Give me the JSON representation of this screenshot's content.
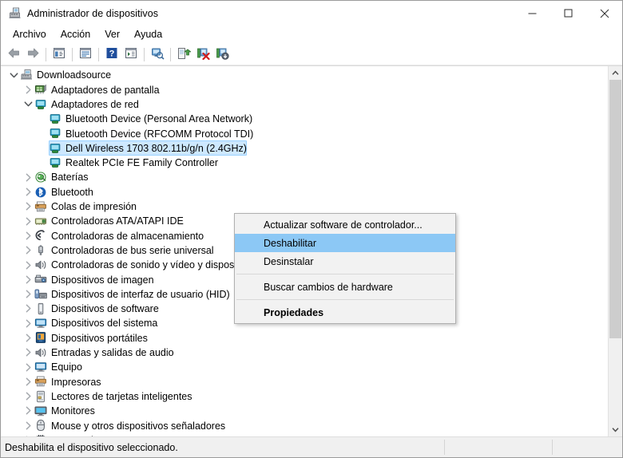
{
  "window": {
    "title": "Administrador de dispositivos",
    "title_icon": "device-manager-icon",
    "minimize_label": "—",
    "maximize_label": "□",
    "close_label": "✕"
  },
  "menubar": {
    "items": [
      {
        "label": "Archivo",
        "name": "menu-archivo"
      },
      {
        "label": "Acción",
        "name": "menu-accion"
      },
      {
        "label": "Ver",
        "name": "menu-ver"
      },
      {
        "label": "Ayuda",
        "name": "menu-ayuda"
      }
    ]
  },
  "toolbar": {
    "buttons": [
      {
        "name": "back-button",
        "icon": "back-arrow-icon"
      },
      {
        "name": "forward-button",
        "icon": "forward-arrow-icon"
      },
      {
        "name": "separator-1",
        "icon": "separator"
      },
      {
        "name": "show-hide-console-tree-button",
        "icon": "console-tree-icon"
      },
      {
        "name": "separator-2",
        "icon": "separator"
      },
      {
        "name": "properties-button",
        "icon": "properties-window-icon"
      },
      {
        "name": "separator-3",
        "icon": "separator"
      },
      {
        "name": "help-button",
        "icon": "help-question-icon"
      },
      {
        "name": "view-button",
        "icon": "view-list-icon"
      },
      {
        "name": "separator-4",
        "icon": "separator"
      },
      {
        "name": "scan-hardware-changes-button",
        "icon": "scan-hardware-icon"
      },
      {
        "name": "separator-5",
        "icon": "separator"
      },
      {
        "name": "update-driver-button",
        "icon": "update-driver-icon"
      },
      {
        "name": "uninstall-device-button",
        "icon": "uninstall-device-icon"
      },
      {
        "name": "disable-device-button",
        "icon": "disable-device-icon"
      }
    ]
  },
  "tree": {
    "nodes": [
      {
        "label": "Downloadsource",
        "indent": 0,
        "chevron": "expanded",
        "icon": "computer-icon",
        "selected": false
      },
      {
        "label": "Adaptadores de pantalla",
        "indent": 1,
        "chevron": "collapsed",
        "icon": "display-adapter-icon",
        "selected": false
      },
      {
        "label": "Adaptadores de red",
        "indent": 1,
        "chevron": "expanded",
        "icon": "network-adapter-icon",
        "selected": false
      },
      {
        "label": "Bluetooth Device (Personal Area Network)",
        "indent": 2,
        "chevron": "none",
        "icon": "network-adapter-icon",
        "selected": false
      },
      {
        "label": "Bluetooth Device (RFCOMM Protocol TDI)",
        "indent": 2,
        "chevron": "none",
        "icon": "network-adapter-icon",
        "selected": false
      },
      {
        "label": "Dell Wireless 1703 802.11b/g/n (2.4GHz)",
        "indent": 2,
        "chevron": "none",
        "icon": "network-adapter-icon",
        "selected": true
      },
      {
        "label": "Realtek PCIe FE Family Controller",
        "indent": 2,
        "chevron": "none",
        "icon": "network-adapter-icon",
        "selected": false
      },
      {
        "label": "Baterías",
        "indent": 1,
        "chevron": "collapsed",
        "icon": "battery-icon",
        "selected": false
      },
      {
        "label": "Bluetooth",
        "indent": 1,
        "chevron": "collapsed",
        "icon": "bluetooth-icon",
        "selected": false
      },
      {
        "label": "Colas de impresión",
        "indent": 1,
        "chevron": "collapsed",
        "icon": "print-queue-icon",
        "selected": false
      },
      {
        "label": "Controladoras ATA/ATAPI IDE",
        "indent": 1,
        "chevron": "collapsed",
        "icon": "ide-controller-icon",
        "selected": false
      },
      {
        "label": "Controladoras de almacenamiento",
        "indent": 1,
        "chevron": "collapsed",
        "icon": "storage-controller-icon",
        "selected": false
      },
      {
        "label": "Controladoras de bus serie universal",
        "indent": 1,
        "chevron": "collapsed",
        "icon": "usb-controller-icon",
        "selected": false
      },
      {
        "label": "Controladoras de sonido y vídeo y dispositivos de juego",
        "indent": 1,
        "chevron": "collapsed",
        "icon": "sound-device-icon",
        "selected": false
      },
      {
        "label": "Dispositivos de imagen",
        "indent": 1,
        "chevron": "collapsed",
        "icon": "imaging-device-icon",
        "selected": false
      },
      {
        "label": "Dispositivos de interfaz de usuario (HID)",
        "indent": 1,
        "chevron": "collapsed",
        "icon": "hid-device-icon",
        "selected": false
      },
      {
        "label": "Dispositivos de software",
        "indent": 1,
        "chevron": "collapsed",
        "icon": "software-device-icon",
        "selected": false
      },
      {
        "label": "Dispositivos del sistema",
        "indent": 1,
        "chevron": "collapsed",
        "icon": "system-device-icon",
        "selected": false
      },
      {
        "label": "Dispositivos portátiles",
        "indent": 1,
        "chevron": "collapsed",
        "icon": "portable-device-icon",
        "selected": false
      },
      {
        "label": "Entradas y salidas de audio",
        "indent": 1,
        "chevron": "collapsed",
        "icon": "audio-io-icon",
        "selected": false
      },
      {
        "label": "Equipo",
        "indent": 1,
        "chevron": "collapsed",
        "icon": "computer-device-icon",
        "selected": false
      },
      {
        "label": "Impresoras",
        "indent": 1,
        "chevron": "collapsed",
        "icon": "printer-icon",
        "selected": false
      },
      {
        "label": "Lectores de tarjetas inteligentes",
        "indent": 1,
        "chevron": "collapsed",
        "icon": "smartcard-reader-icon",
        "selected": false
      },
      {
        "label": "Monitores",
        "indent": 1,
        "chevron": "collapsed",
        "icon": "monitor-icon",
        "selected": false
      },
      {
        "label": "Mouse y otros dispositivos señaladores",
        "indent": 1,
        "chevron": "collapsed",
        "icon": "mouse-icon",
        "selected": false
      },
      {
        "label": "Procesadores",
        "indent": 1,
        "chevron": "collapsed",
        "icon": "processor-icon",
        "selected": false
      }
    ]
  },
  "context_menu": {
    "items": [
      {
        "label": "Actualizar software de controlador...",
        "name": "ctx-update-driver",
        "type": "item",
        "highlighted": false,
        "bold": false
      },
      {
        "label": "Deshabilitar",
        "name": "ctx-disable",
        "type": "item",
        "highlighted": true,
        "bold": false
      },
      {
        "label": "Desinstalar",
        "name": "ctx-uninstall",
        "type": "item",
        "highlighted": false,
        "bold": false
      },
      {
        "label": "",
        "name": "ctx-separator-1",
        "type": "separator",
        "highlighted": false,
        "bold": false
      },
      {
        "label": "Buscar cambios de hardware",
        "name": "ctx-scan-hardware",
        "type": "item",
        "highlighted": false,
        "bold": false
      },
      {
        "label": "",
        "name": "ctx-separator-2",
        "type": "separator",
        "highlighted": false,
        "bold": false
      },
      {
        "label": "Propiedades",
        "name": "ctx-properties",
        "type": "item",
        "highlighted": false,
        "bold": true
      }
    ]
  },
  "statusbar": {
    "text": "Deshabilita el dispositivo seleccionado."
  },
  "scrollbar": {
    "up_arrow": "ⱏ",
    "down_arrow": "ⱟ"
  },
  "colors": {
    "selection_fill": "#cde8ff",
    "selection_border": "#99d1ff",
    "menu_highlight": "#8cc8f5",
    "menu_bg": "#f2f2f2",
    "status_bg": "#f0f0f0",
    "scroll_thumb": "#cdcdcd"
  }
}
